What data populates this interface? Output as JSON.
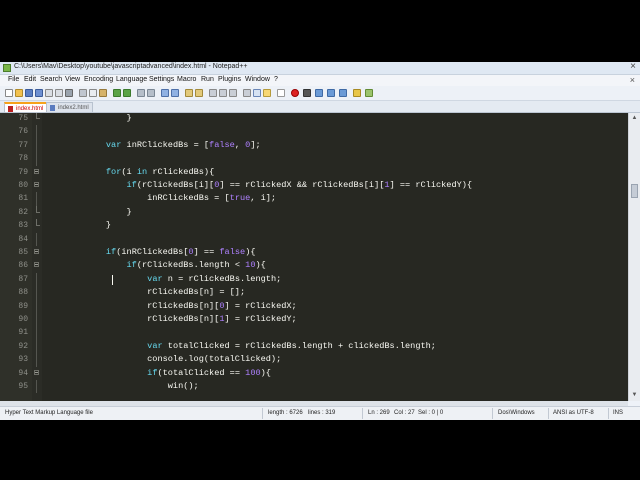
{
  "window": {
    "title": "C:\\Users\\Mav\\Desktop\\youtube\\javascriptadvanced\\index.html - Notepad++"
  },
  "menu": [
    "File",
    "Edit",
    "Search",
    "View",
    "Encoding",
    "Language",
    "Settings",
    "Macro",
    "Run",
    "Plugins",
    "Window",
    "?"
  ],
  "tabs": [
    {
      "label": "index.html",
      "active": true
    },
    {
      "label": "index2.html",
      "active": false
    }
  ],
  "editor": {
    "lines": [
      {
        "no": "75",
        "text": "                }",
        "fold": "end"
      },
      {
        "no": "76",
        "text": "",
        "fold": "guide"
      },
      {
        "no": "77",
        "text": "            var inRClickedBs = [false, 0];",
        "fold": "guide"
      },
      {
        "no": "78",
        "text": "",
        "fold": "guide"
      },
      {
        "no": "79",
        "text": "            for(i in rClickedBs){",
        "fold": "open"
      },
      {
        "no": "80",
        "text": "                if(rClickedBs[i][0] == rClickedX && rClickedBs[i][1] == rClickedY){",
        "fold": "open"
      },
      {
        "no": "81",
        "text": "                    inRClickedBs = [true, i];",
        "fold": "guide"
      },
      {
        "no": "82",
        "text": "                }",
        "fold": "end"
      },
      {
        "no": "83",
        "text": "            }",
        "fold": "end"
      },
      {
        "no": "84",
        "text": "",
        "fold": "guide"
      },
      {
        "no": "85",
        "text": "            if(inRClickedBs[0] == false){",
        "fold": "open"
      },
      {
        "no": "86",
        "text": "                if(rClickedBs.length < 10){",
        "fold": "open"
      },
      {
        "no": "87",
        "text": "                    var n = rClickedBs.length;",
        "fold": "guide"
      },
      {
        "no": "88",
        "text": "                    rClickedBs[n] = [];",
        "fold": "guide"
      },
      {
        "no": "89",
        "text": "                    rClickedBs[n][0] = rClickedX;",
        "fold": "guide"
      },
      {
        "no": "90",
        "text": "                    rClickedBs[n][1] = rClickedY;",
        "fold": "guide"
      },
      {
        "no": "91",
        "text": "",
        "fold": "guide"
      },
      {
        "no": "92",
        "text": "                    var totalClicked = rClickedBs.length + clickedBs.length;",
        "fold": "guide"
      },
      {
        "no": "93",
        "text": "                    console.log(totalClicked);",
        "fold": "guide"
      },
      {
        "no": "94",
        "text": "                    if(totalClicked == 100){",
        "fold": "open"
      },
      {
        "no": "95",
        "text": "                        win();",
        "fold": "guide"
      }
    ]
  },
  "status": {
    "file_type": "Hyper Text Markup Language file",
    "length": "length : 6726",
    "lines": "lines : 319",
    "ln": "Ln : 269",
    "col": "Col : 27",
    "sel": "Sel : 0 | 0",
    "eol": "Dos\\Windows",
    "encoding": "ANSI as UTF-8",
    "mode": "INS"
  },
  "icons": {
    "app": "notepadpp-icon",
    "close": "close-icon",
    "tab_doc": "document-icon"
  },
  "colors": {
    "editor_bg": "#272822",
    "text": "#f8f8f2",
    "keyword": "#66d9ef",
    "constant": "#ae81ff",
    "tab_accent": "#f7a21b"
  },
  "caret": {
    "line": "87",
    "column": 27
  }
}
